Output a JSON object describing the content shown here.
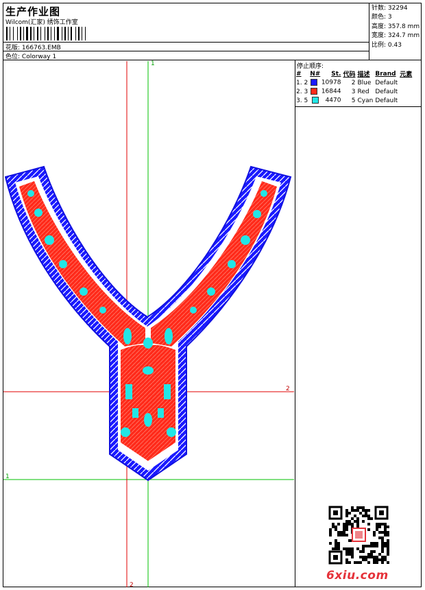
{
  "header": {
    "title": "生产作业图",
    "company": "Wilcom(汇家) 绣饰工作室",
    "pattern_label": "花版:",
    "pattern_file": "166763.EMB",
    "colorway_label": "色位:",
    "colorway_name": "Colorway 1"
  },
  "stats": {
    "stitches_label": "针数:",
    "stitches": "32294",
    "colors_label": "颜色:",
    "colors": "3",
    "height_label": "高度:",
    "height": "357.8 mm",
    "width_label": "宽度:",
    "width": "324.7 mm",
    "scale_label": "比例:",
    "scale": "0.43"
  },
  "stop_sequence": {
    "title": "停止顺序:",
    "columns": [
      "#",
      "N#",
      "",
      "St.",
      "代码",
      "描述",
      "Brand",
      "元素"
    ],
    "rows": [
      {
        "seq": "1. 2",
        "stitches": "10978",
        "code": "2",
        "desc": "Blue",
        "brand": "Default",
        "color": "#1a1aff"
      },
      {
        "seq": "2. 3",
        "stitches": "16844",
        "code": "3",
        "desc": "Red",
        "brand": "Default",
        "color": "#ff2a1a"
      },
      {
        "seq": "3. 5",
        "stitches": "4470",
        "code": "5",
        "desc": "Cyan",
        "brand": "Default",
        "color": "#22e6e6"
      }
    ]
  },
  "guides": {
    "green_top": "1",
    "green_left": "1",
    "red_right": "2",
    "red_bottom": "2"
  },
  "palette": {
    "blue": "#1a1aff",
    "red": "#ff2a1a",
    "cyan": "#22e6e6",
    "guide_red": "#e00000",
    "guide_green": "#00c000"
  },
  "watermark": "6xiu.com"
}
